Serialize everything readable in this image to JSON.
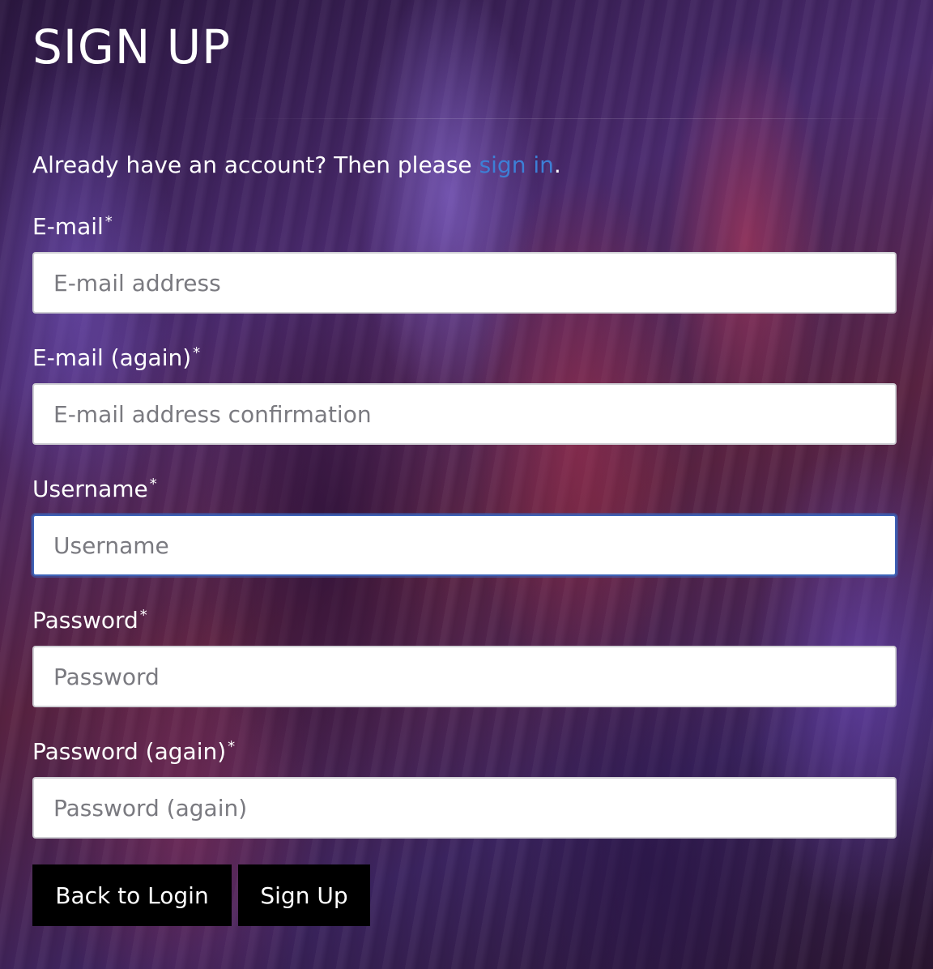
{
  "page": {
    "title": "SIGN UP",
    "intro_text": "Already have an account? Then please ",
    "intro_link": "sign in",
    "intro_suffix": "."
  },
  "form": {
    "required_marker": "*",
    "fields": [
      {
        "label": "E-mail",
        "placeholder": "E-mail address",
        "value": ""
      },
      {
        "label": "E-mail (again)",
        "placeholder": "E-mail address confirmation",
        "value": ""
      },
      {
        "label": "Username",
        "placeholder": "Username",
        "value": "",
        "focused": true
      },
      {
        "label": "Password",
        "placeholder": "Password",
        "value": ""
      },
      {
        "label": "Password (again)",
        "placeholder": "Password (again)",
        "value": ""
      }
    ]
  },
  "actions": {
    "back_label": "Back to Login",
    "signup_label": "Sign Up"
  },
  "colors": {
    "link": "#3d7fd6",
    "button_bg": "#000000",
    "focus_border": "#3d63b8"
  }
}
